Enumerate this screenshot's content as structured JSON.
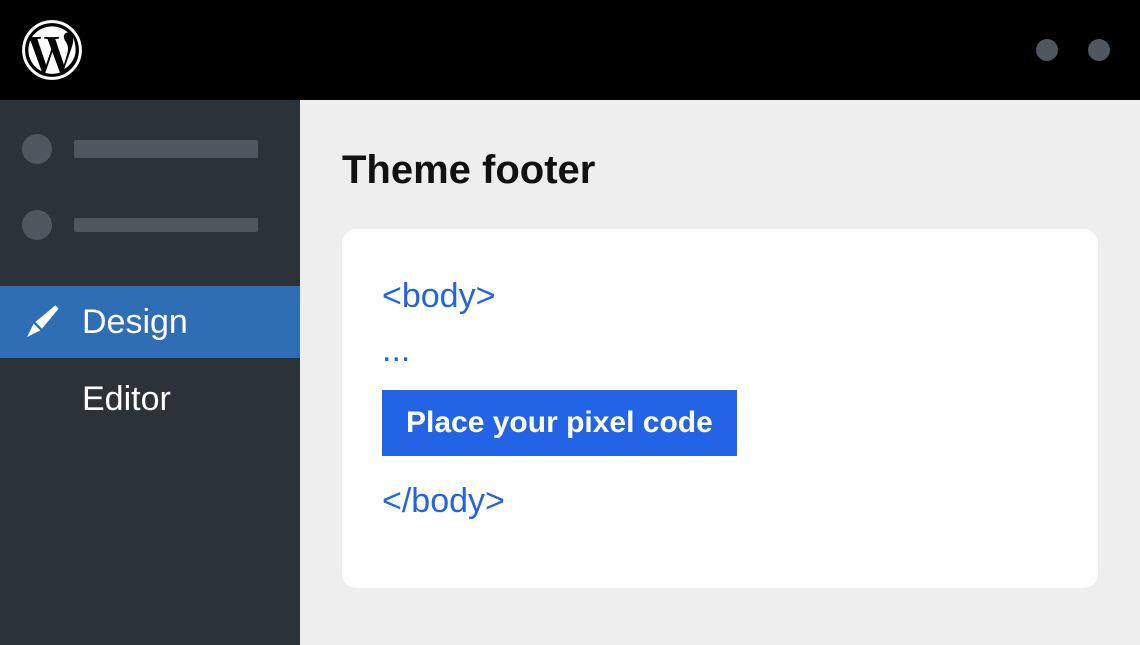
{
  "sidebar": {
    "design_label": "Design",
    "editor_label": "Editor"
  },
  "main": {
    "title": "Theme footer",
    "code": {
      "open_tag": "<body>",
      "ellipsis": "...",
      "pixel_banner": "Place your pixel code",
      "close_tag": "</body>"
    }
  }
}
